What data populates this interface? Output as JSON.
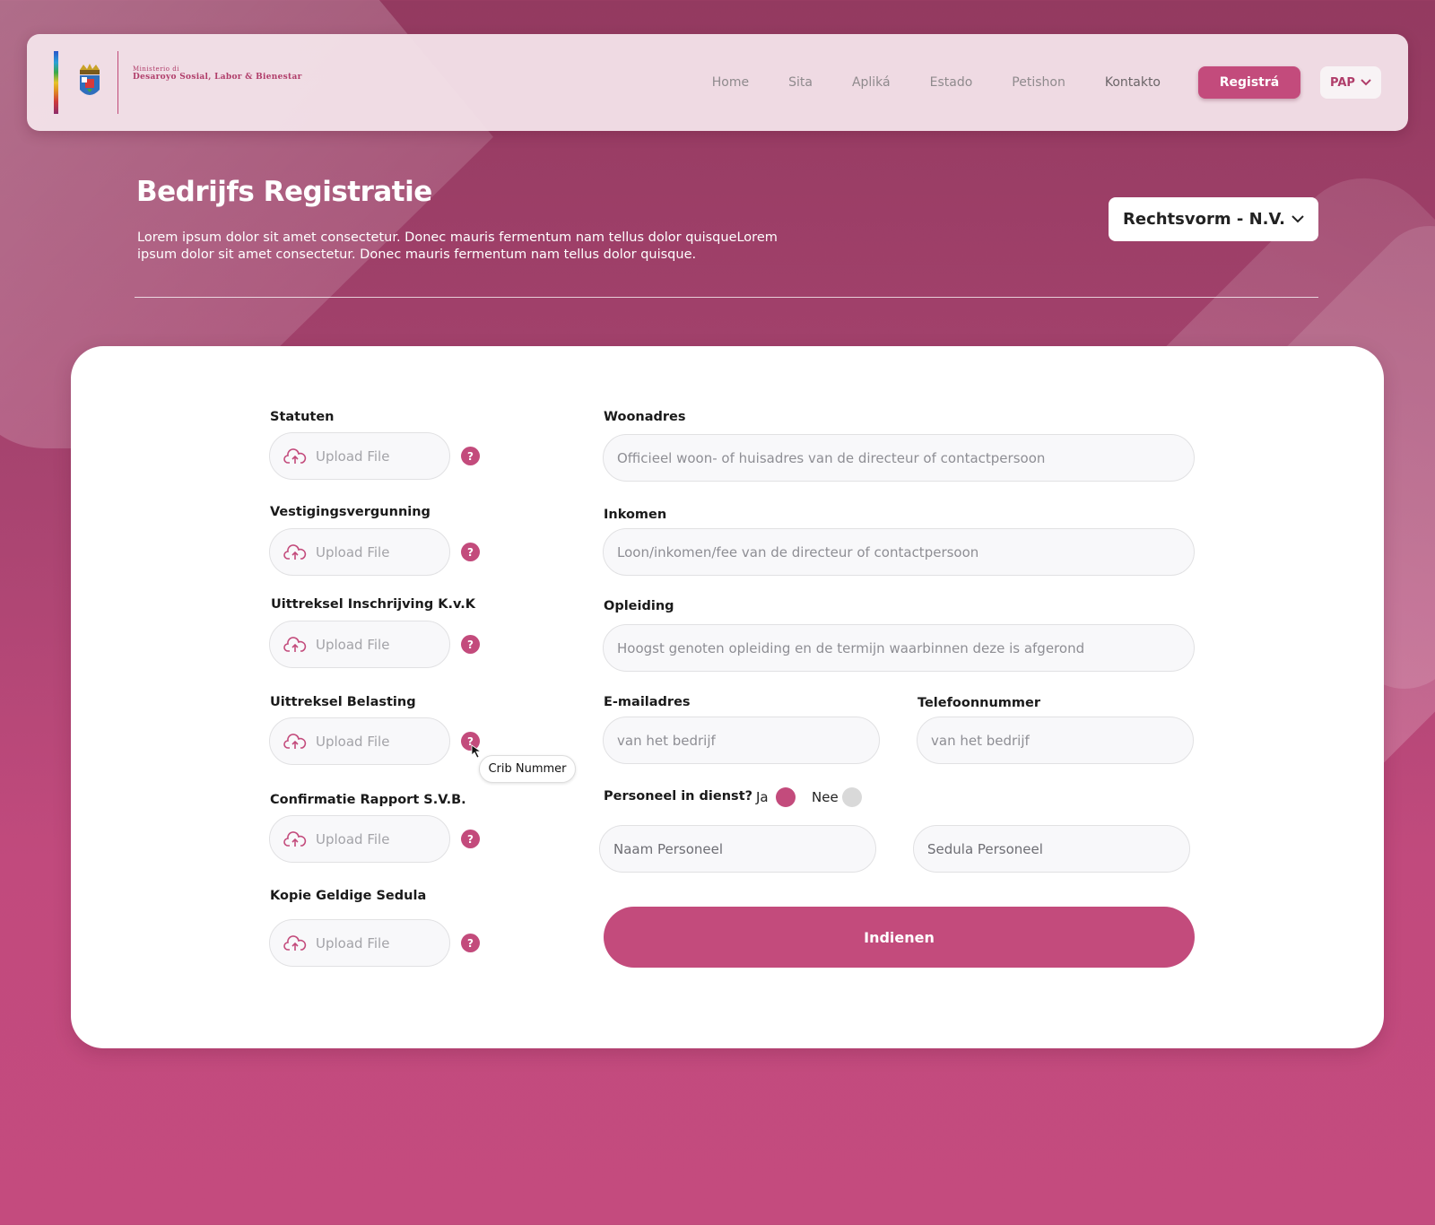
{
  "header": {
    "logo_small": "Ministerio di",
    "logo_big": "Desaroyo Sosial, Labor & Bienestar",
    "nav": [
      "Home",
      "Sita",
      "Apliká",
      "Estado",
      "Petishon",
      "Kontakto"
    ],
    "register_label": "Registrá",
    "language": "PAP"
  },
  "hero": {
    "title": "Bedrijfs Registratie",
    "description": "Lorem ipsum dolor sit amet consectetur. Donec mauris fermentum nam tellus dolor quisqueLorem ipsum dolor sit amet consectetur. Donec mauris fermentum nam tellus dolor quisque.",
    "rechtsvorm": "Rechtsvorm - N.V."
  },
  "uploads": [
    {
      "label": "Statuten",
      "button": "Upload File"
    },
    {
      "label": "Vestigingsvergunning",
      "button": "Upload File"
    },
    {
      "label": "Uittreksel Inschrijving K.v.K",
      "button": "Upload File"
    },
    {
      "label": "Uittreksel Belasting",
      "button": "Upload File"
    },
    {
      "label": "Confirmatie Rapport S.V.B.",
      "button": "Upload File"
    },
    {
      "label": "Kopie Geldige Sedula",
      "button": "Upload File"
    }
  ],
  "tooltip": "Crib Nummer",
  "fields": {
    "woonadres": {
      "label": "Woonadres",
      "placeholder": "Officieel woon- of huisadres van de directeur of contactpersoon"
    },
    "inkomen": {
      "label": "Inkomen",
      "placeholder": "Loon/inkomen/fee van de directeur of contactpersoon"
    },
    "opleiding": {
      "label": "Opleiding",
      "placeholder": "Hoogst genoten opleiding en de termijn waarbinnen deze is afgerond"
    },
    "email": {
      "label": "E-mailadres",
      "placeholder": "van het bedrijf"
    },
    "telefoon": {
      "label": "Telefoonnummer",
      "placeholder": "van het bedrijf"
    }
  },
  "personeel": {
    "question": "Personeel in dienst?",
    "yes": "Ja",
    "no": "Nee",
    "selected": "Ja",
    "naam_placeholder": "Naam Personeel",
    "sedula_placeholder": "Sedula Personeel"
  },
  "submit_label": "Indienen",
  "colors": {
    "accent": "#c34b7c",
    "background": "#a84470",
    "radio_off": "#d9d9d9"
  }
}
